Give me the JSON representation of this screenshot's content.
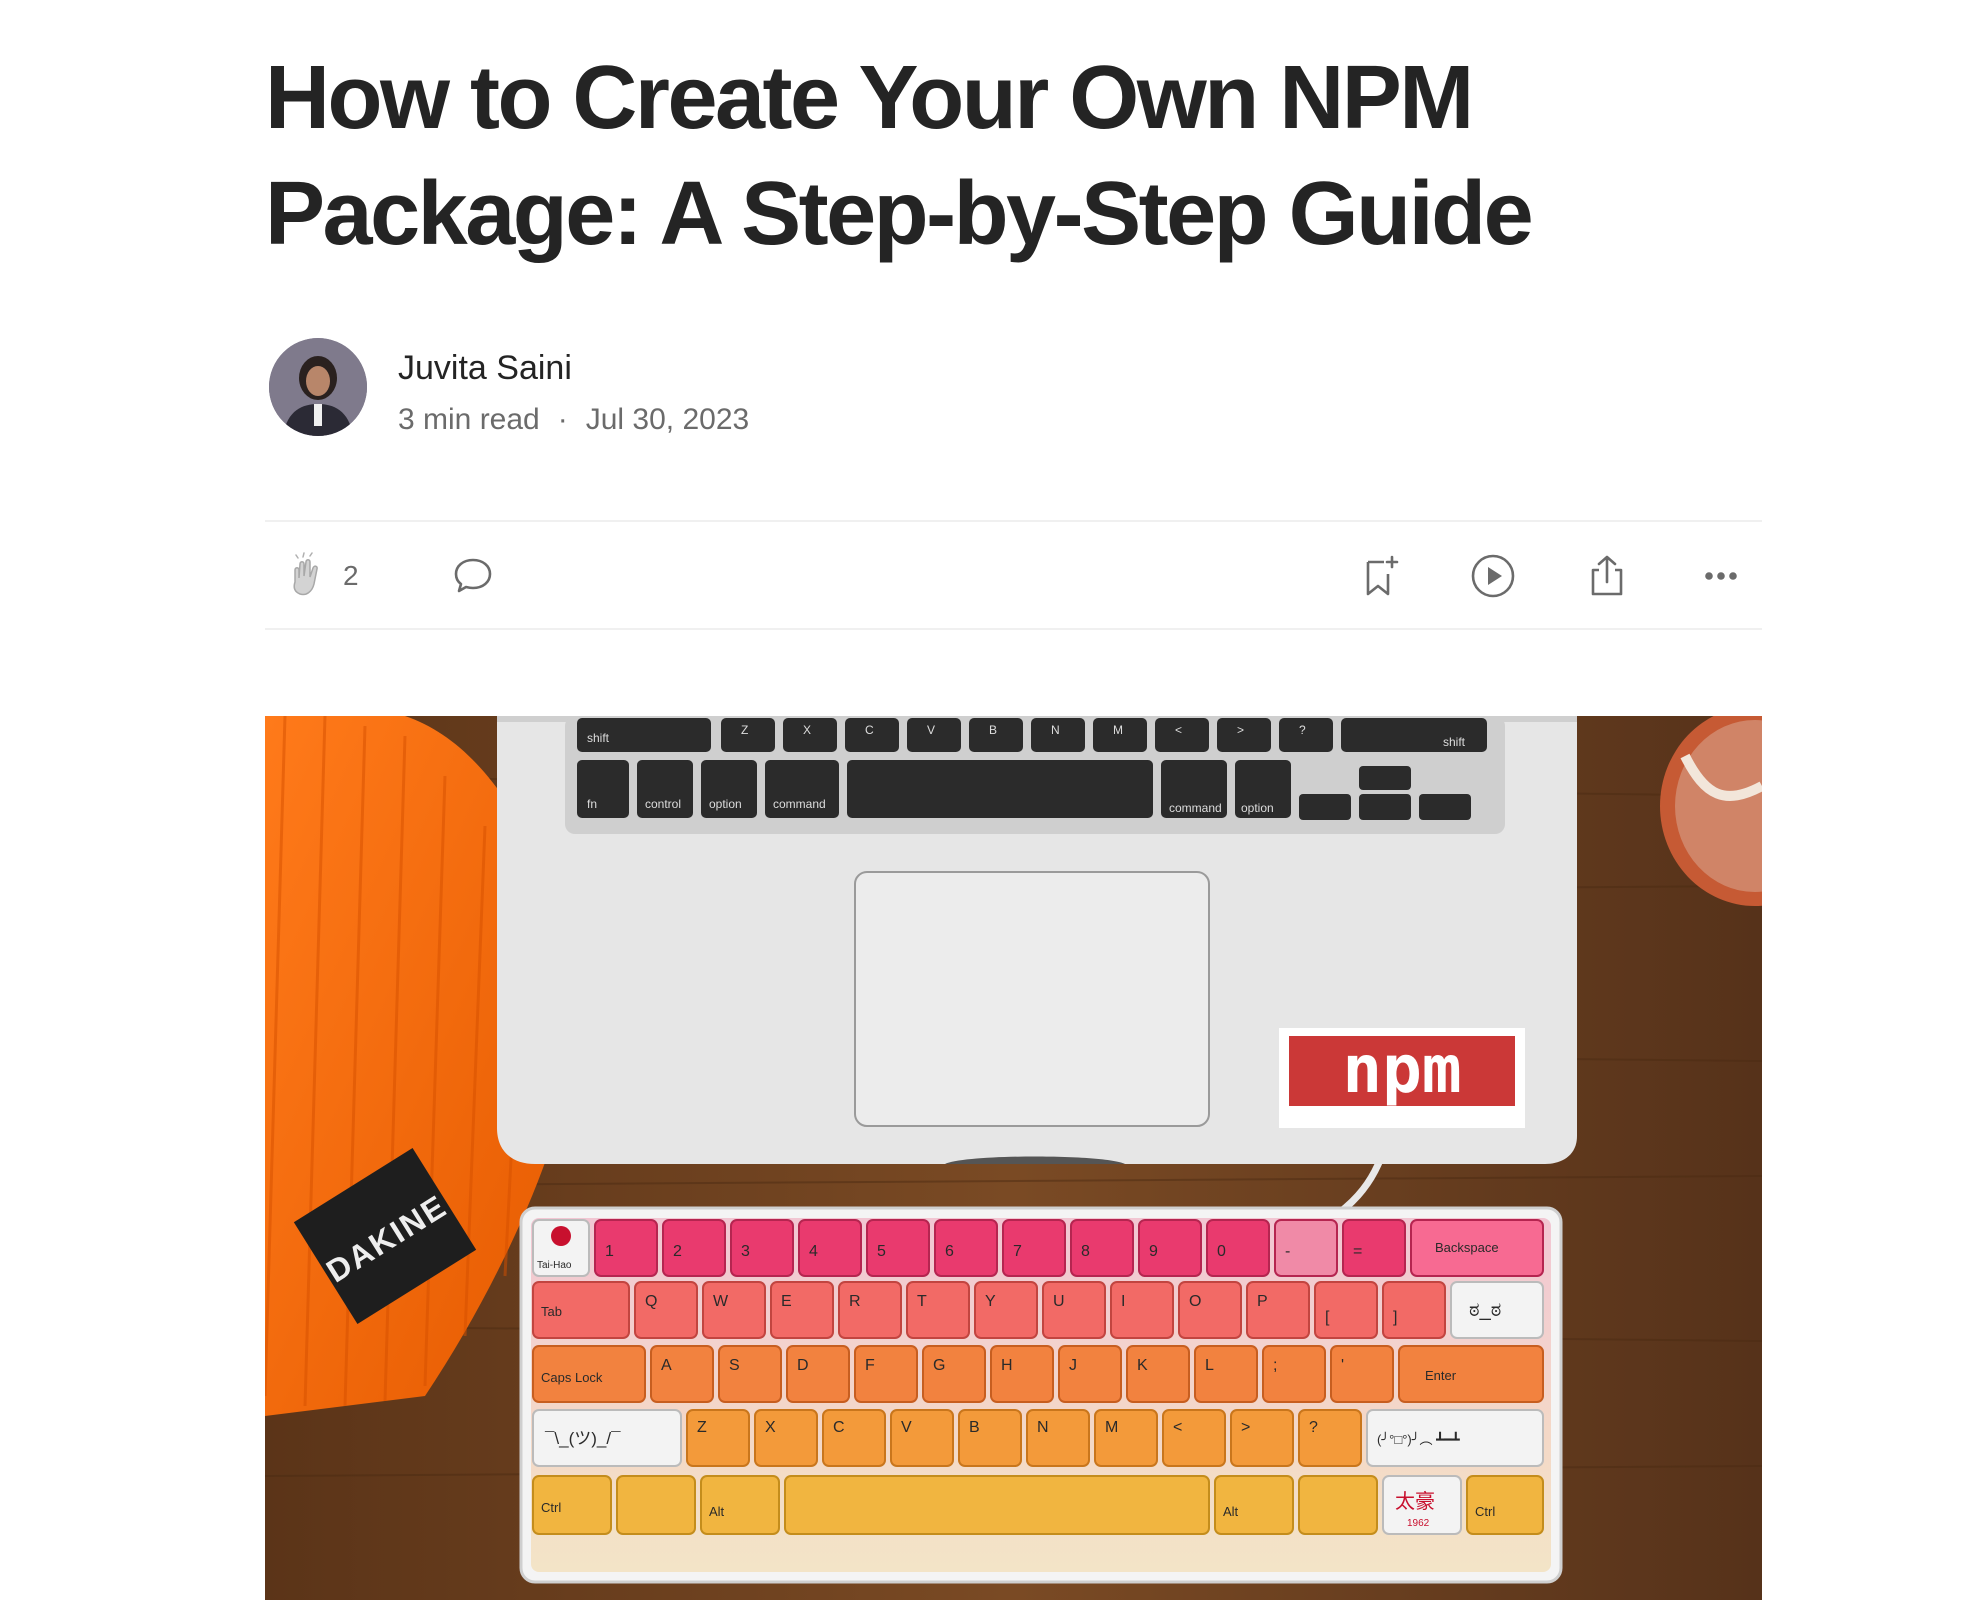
{
  "article": {
    "title": "How to Create Your Own NPM Package: A Step-by-Step Guide",
    "author": "Juvita Saini",
    "read_time": "3 min read",
    "separator": "·",
    "date": "Jul 30, 2023"
  },
  "actions": {
    "clap_count": "2",
    "icons": [
      "clap-icon",
      "comment-icon",
      "bookmark-add-icon",
      "play-icon",
      "share-icon",
      "more-icon"
    ]
  },
  "hero_image": {
    "npm_sticker": "npm",
    "beanie_label": "DAKINE",
    "keyboard_legends": {
      "row0": [
        "Tai-Hao",
        "1",
        "2",
        "3",
        "4",
        "5",
        "6",
        "7",
        "8",
        "9",
        "0",
        "-",
        "=",
        "Backspace"
      ],
      "row1": [
        "Tab",
        "Q",
        "W",
        "E",
        "R",
        "T",
        "Y",
        "U",
        "I",
        "O",
        "P",
        "[",
        "]",
        "ಠ_ಠ"
      ],
      "row2": [
        "Caps Lock",
        "A",
        "S",
        "D",
        "F",
        "G",
        "H",
        "J",
        "K",
        "L",
        ";",
        "'",
        "Enter"
      ],
      "row3": [
        "¯\\_(ツ)_/¯",
        "Z",
        "X",
        "C",
        "V",
        "B",
        "N",
        "M",
        "<",
        ">",
        "?",
        "(╯°□°)╯︵ ┻━┻"
      ],
      "row4": [
        "Ctrl",
        "Alt",
        "Alt",
        "Ctrl",
        "太豪",
        "1962"
      ]
    },
    "laptop_legends": {
      "row_a": [
        "shift",
        "Z",
        "X",
        "C",
        "V",
        "B",
        "N",
        "M",
        "<",
        ">",
        "?",
        "shift"
      ],
      "row_b": [
        "fn",
        "control",
        "option",
        "command",
        "command",
        "option"
      ]
    }
  }
}
